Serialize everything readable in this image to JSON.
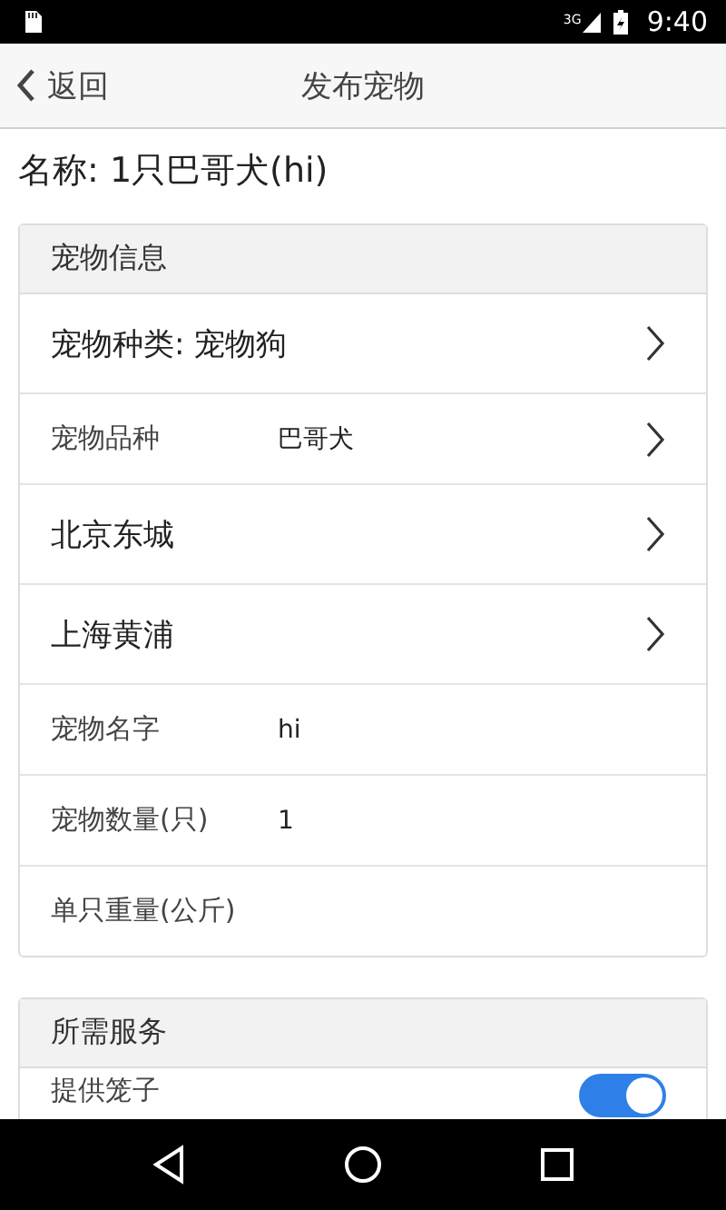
{
  "status_bar": {
    "time": "9:40",
    "network": "3G"
  },
  "header": {
    "back": "返回",
    "title": "发布宠物"
  },
  "name_line": "名称: 1只巴哥犬(hi)",
  "sections": [
    {
      "title": "宠物信息",
      "rows": [
        {
          "kind": "choice",
          "label": "宠物种类: 宠物狗",
          "chevron": true
        },
        {
          "kind": "field",
          "label": "宠物品种",
          "value": "巴哥犬",
          "chevron": true
        },
        {
          "kind": "choice",
          "label": "北京东城",
          "chevron": true
        },
        {
          "kind": "choice",
          "label": "上海黄浦",
          "chevron": true
        },
        {
          "kind": "field",
          "label": "宠物名字",
          "value": "hi"
        },
        {
          "kind": "field",
          "label": "宠物数量(只)",
          "value": "1"
        },
        {
          "kind": "field",
          "label": "单只重量(公斤)"
        }
      ]
    },
    {
      "title": "所需服务",
      "rows": [
        {
          "kind": "toggle",
          "label": "提供笼子",
          "on": true
        }
      ]
    }
  ]
}
